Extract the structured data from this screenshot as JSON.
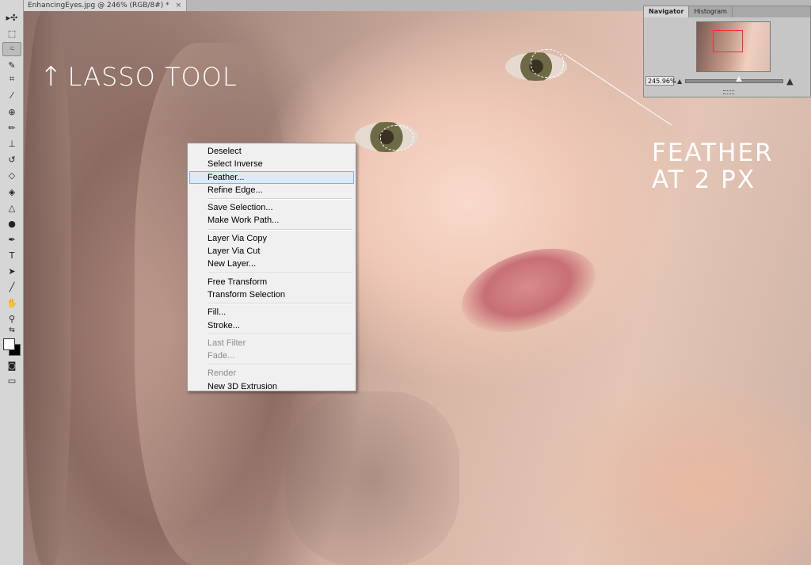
{
  "document": {
    "tab_title": "EnhancingEyes.jpg @ 246% (RGB/8#) *",
    "close_glyph": "×"
  },
  "toolbar": {
    "tools": [
      {
        "name": "move-tool-icon",
        "glyph": "▸✣"
      },
      {
        "name": "marquee-tool-icon",
        "glyph": "⬚"
      },
      {
        "name": "lasso-tool-icon",
        "glyph": "⍨"
      },
      {
        "name": "quick-selection-tool-icon",
        "glyph": "✎"
      },
      {
        "name": "crop-tool-icon",
        "glyph": "⌗"
      },
      {
        "name": "eyedropper-tool-icon",
        "glyph": "⁄"
      },
      {
        "name": "healing-brush-tool-icon",
        "glyph": "⊕"
      },
      {
        "name": "brush-tool-icon",
        "glyph": "✏"
      },
      {
        "name": "clone-stamp-tool-icon",
        "glyph": "⊥"
      },
      {
        "name": "history-brush-tool-icon",
        "glyph": "↺"
      },
      {
        "name": "eraser-tool-icon",
        "glyph": "◇"
      },
      {
        "name": "paint-bucket-tool-icon",
        "glyph": "◈"
      },
      {
        "name": "blur-tool-icon",
        "glyph": "△"
      },
      {
        "name": "dodge-tool-icon",
        "glyph": "●"
      },
      {
        "name": "pen-tool-icon",
        "glyph": "✒"
      },
      {
        "name": "type-tool-icon",
        "glyph": "T"
      },
      {
        "name": "path-selection-tool-icon",
        "glyph": "➤"
      },
      {
        "name": "line-tool-icon",
        "glyph": "╱"
      },
      {
        "name": "hand-tool-icon",
        "glyph": "✋"
      },
      {
        "name": "zoom-tool-icon",
        "glyph": "⚲"
      }
    ],
    "swap_colors_glyph": "⇆",
    "quick_mask_glyph": "◙",
    "screen_mode_glyph": "▭",
    "foreground_color": "#ffffff",
    "background_color": "#000000",
    "active_tool": "lasso-tool-icon"
  },
  "annotations": {
    "lasso_arrow": "↑",
    "lasso_label": "LASSO TOOL",
    "feather_line1": "FEATHER",
    "feather_line2": "AT 2 PX"
  },
  "navigator": {
    "tabs": [
      {
        "label": "Navigator",
        "active": true
      },
      {
        "label": "Histogram",
        "active": false
      }
    ],
    "zoom_value": "245.96%",
    "zoom_slider_fraction": 0.55
  },
  "context_menu": {
    "groups": [
      [
        {
          "label": "Deselect",
          "state": "normal"
        },
        {
          "label": "Select Inverse",
          "state": "normal"
        },
        {
          "label": "Feather...",
          "state": "hover"
        },
        {
          "label": "Refine Edge...",
          "state": "normal"
        }
      ],
      [
        {
          "label": "Save Selection...",
          "state": "normal"
        },
        {
          "label": "Make Work Path...",
          "state": "normal"
        }
      ],
      [
        {
          "label": "Layer Via Copy",
          "state": "normal"
        },
        {
          "label": "Layer Via Cut",
          "state": "normal"
        },
        {
          "label": "New Layer...",
          "state": "normal"
        }
      ],
      [
        {
          "label": "Free Transform",
          "state": "normal"
        },
        {
          "label": "Transform Selection",
          "state": "normal"
        }
      ],
      [
        {
          "label": "Fill...",
          "state": "normal"
        },
        {
          "label": "Stroke...",
          "state": "normal"
        }
      ],
      [
        {
          "label": "Last Filter",
          "state": "disabled"
        },
        {
          "label": "Fade...",
          "state": "disabled"
        }
      ],
      [
        {
          "label": "Render",
          "state": "disabled"
        },
        {
          "label": "New 3D Extrusion",
          "state": "normal"
        }
      ]
    ]
  }
}
